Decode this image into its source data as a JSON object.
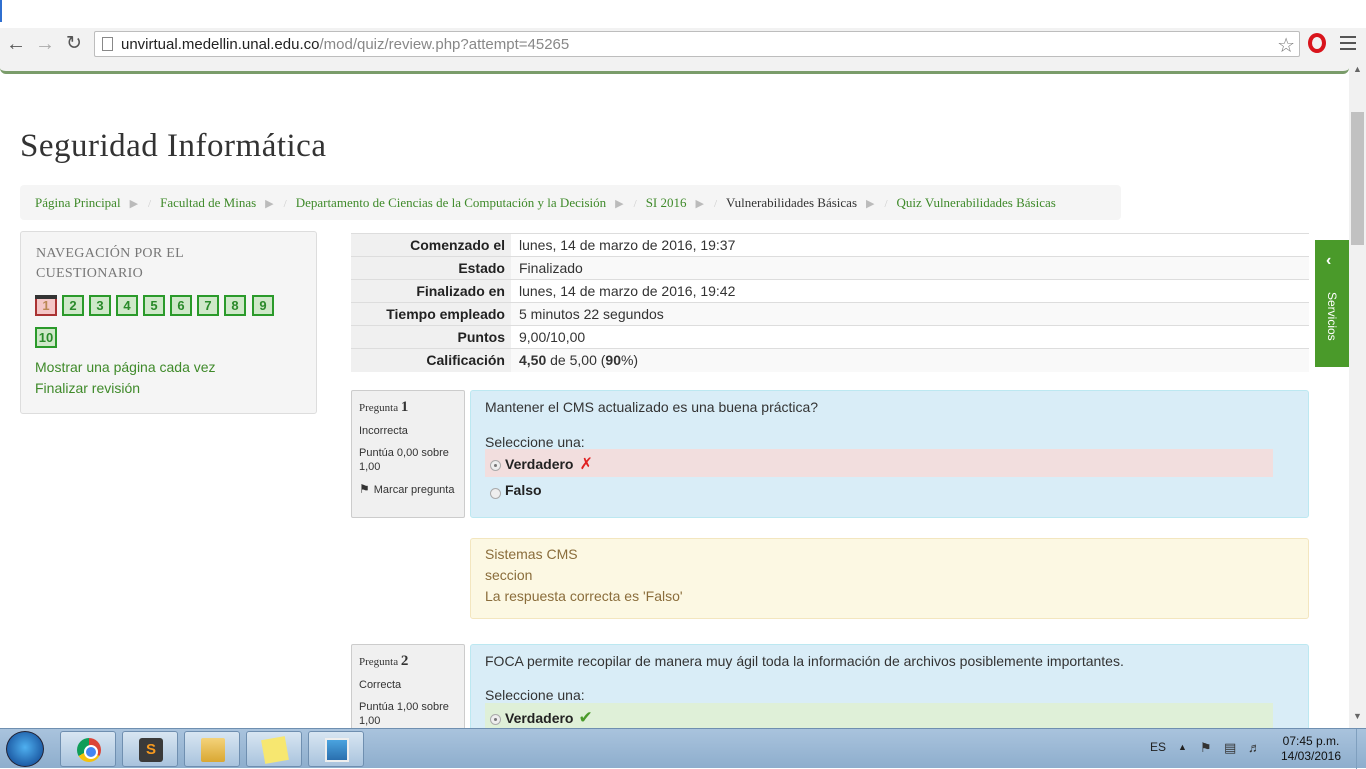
{
  "browser": {
    "url_domain": "unvirtual.medellin.unal.edu.co",
    "url_path": "/mod/quiz/review.php?attempt=45265"
  },
  "site": {
    "title": "Seguridad Informática"
  },
  "breadcrumb": [
    {
      "label": "Página Principal"
    },
    {
      "label": "Facultad de Minas"
    },
    {
      "label": "Departamento de Ciencias de la Computación y la Decisión"
    },
    {
      "label": "SI 2016"
    },
    {
      "label": "Vulnerabilidades Básicas"
    },
    {
      "label": "Quiz Vulnerabilidades Básicas"
    }
  ],
  "quiz_nav": {
    "title": "NAVEGACIÓN POR EL CUESTIONARIO",
    "buttons": [
      "1",
      "2",
      "3",
      "4",
      "5",
      "6",
      "7",
      "8",
      "9",
      "10"
    ],
    "show_one_page": "Mostrar una página cada vez",
    "finish_review": "Finalizar revisión"
  },
  "summary": {
    "rows": [
      {
        "label": "Comenzado el",
        "value": "lunes, 14 de marzo de 2016, 19:37"
      },
      {
        "label": "Estado",
        "value": "Finalizado"
      },
      {
        "label": "Finalizado en",
        "value": "lunes, 14 de marzo de 2016, 19:42"
      },
      {
        "label": "Tiempo empleado",
        "value": "5 minutos 22 segundos"
      },
      {
        "label": "Puntos",
        "value": "9,00/10,00"
      }
    ],
    "grade_label": "Calificación",
    "grade_value": "4,50",
    "grade_mid": " de 5,00 (",
    "grade_pct": "90",
    "grade_end": "%)"
  },
  "questions": [
    {
      "label": "Pregunta",
      "number": "1",
      "state": "Incorrecta",
      "grade": "Puntúa 0,00 sobre 1,00",
      "flag": "Marcar pregunta",
      "text": "Mantener el CMS actualizado es una buena práctica?",
      "prompt": "Seleccione una:",
      "answers": [
        "Verdadero",
        "Falso"
      ],
      "feedback": [
        "Sistemas CMS",
        "seccion",
        "La respuesta correcta es 'Falso'"
      ]
    },
    {
      "label": "Pregunta",
      "number": "2",
      "state": "Correcta",
      "grade": "Puntúa 1,00 sobre 1,00",
      "text": "FOCA permite recopilar de manera muy ágil toda la información de archivos posiblemente importantes.",
      "prompt": "Seleccione una:",
      "answers": [
        "Verdadero"
      ]
    }
  ],
  "side_tab": {
    "label": "Servicios"
  },
  "taskbar": {
    "language": "ES",
    "time": "07:45 p.m.",
    "date": "14/03/2016"
  },
  "colors": {
    "link_green": "#3f8a2a",
    "info_blue": "#d9edf7",
    "incorrect_red": "#f2dede",
    "correct_green": "#dff0d8",
    "feedback_yellow": "#fcf8e3",
    "servicios_green": "#4a9a2a"
  }
}
